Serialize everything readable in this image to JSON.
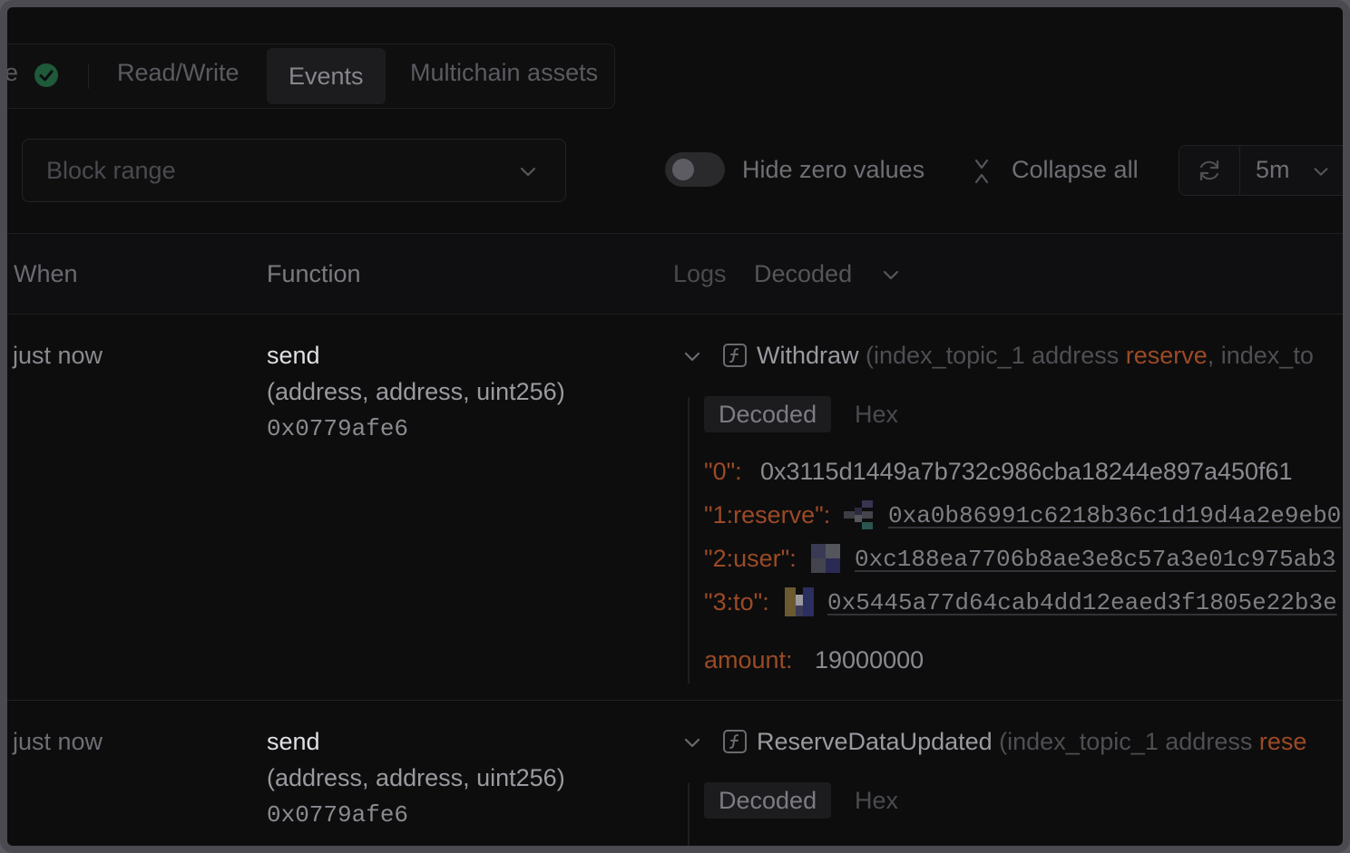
{
  "tabs": {
    "partial": "e",
    "items": [
      {
        "label": "Read/Write"
      },
      {
        "label": "Events",
        "active": true
      },
      {
        "label": "Multichain assets"
      }
    ]
  },
  "filters": {
    "block_range_placeholder": "Block range",
    "hide_zero_label": "Hide zero values",
    "collapse_all_label": "Collapse all",
    "interval": "5m"
  },
  "table": {
    "headers": {
      "when": "When",
      "function": "Function",
      "logs": "Logs",
      "logs_mode": "Decoded"
    },
    "rows": [
      {
        "when": "just now",
        "fn_name": "send",
        "fn_sig": "(address, address, uint256)",
        "fn_selector": "0x0779afe6",
        "event_name": "Withdraw",
        "event_p1": " (index_topic_1 address ",
        "event_p2": "reserve",
        "event_p3": ", index_to",
        "view_decoded": "Decoded",
        "view_hex": "Hex",
        "fields": [
          {
            "key": "\"0\":",
            "value": "0x3115d1449a7b732c986cba18244e897a450f61"
          },
          {
            "key": "\"1:reserve\":",
            "value": "0xa0b86991c6218b36c1d19d4a2e9eb0"
          },
          {
            "key": "\"2:user\":",
            "value": "0xc188ea7706b8ae3e8c57a3e01c975ab3"
          },
          {
            "key": "\"3:to\":",
            "value": "0x5445a77d64cab4dd12eaed3f1805e22b3e"
          }
        ],
        "amount_key": "amount:",
        "amount_value": "19000000"
      },
      {
        "when": "just now",
        "fn_name": "send",
        "fn_sig": "(address, address, uint256)",
        "fn_selector": "0x0779afe6",
        "event_name": "ReserveDataUpdated",
        "event_p1": " (index_topic_1 address ",
        "event_p2": "rese",
        "view_decoded": "Decoded",
        "view_hex": "Hex"
      }
    ]
  },
  "colors": {
    "accent_orange": "#9b4a25",
    "check_green": "#1f5a3a"
  }
}
